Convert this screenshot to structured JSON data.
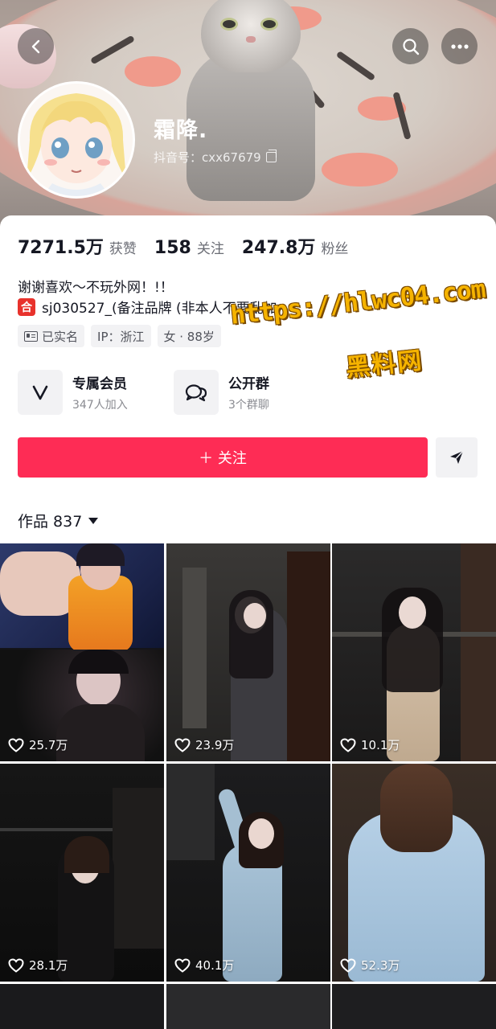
{
  "header": {
    "nickname": "霜降.",
    "douyin_id": "抖音号：cxx67679",
    "icons": [
      "back-icon",
      "search-icon",
      "more-icon"
    ]
  },
  "stats": [
    {
      "value": "7271.5万",
      "label": "获赞"
    },
    {
      "value": "158",
      "label": "关注"
    },
    {
      "value": "247.8万",
      "label": "粉丝"
    }
  ],
  "bio": {
    "line1": "谢谢喜欢～不玩外网！!！",
    "line2_emoji": "合",
    "line2": "sj030527_(备注品牌 (非本人不要乱加"
  },
  "tags": [
    {
      "label": "已实名",
      "icon": "id-card-icon"
    },
    {
      "label": "IP：浙江"
    },
    {
      "label": "女 · 88岁"
    }
  ],
  "entries": [
    {
      "title": "专属会员",
      "sub": "347人加入",
      "icon": "v-icon"
    },
    {
      "title": "公开群",
      "sub": "3个群聊",
      "icon": "chat-icon"
    }
  ],
  "follow_label": "＋ 关注",
  "works_label": "作品 837",
  "watermark": {
    "line1": "https://hlwc04.com",
    "line2": "黑料网"
  },
  "videos": [
    {
      "likes": "25.7万"
    },
    {
      "likes": "23.9万"
    },
    {
      "likes": "10.1万"
    },
    {
      "likes": "28.1万"
    },
    {
      "likes": "40.1万"
    },
    {
      "likes": "52.3万"
    }
  ],
  "colors": {
    "accent": "#fe2c55",
    "watermark": "#f5b300"
  }
}
